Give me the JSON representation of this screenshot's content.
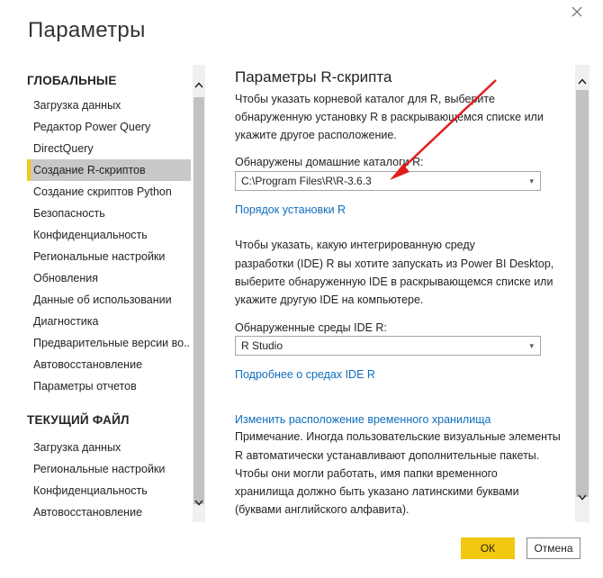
{
  "window": {
    "title": "Параметры",
    "close_glyph": "✕"
  },
  "sidebar": {
    "global_header": "ГЛОБАЛЬНЫЕ",
    "global_items": [
      {
        "label": "Загрузка данных"
      },
      {
        "label": "Редактор Power Query"
      },
      {
        "label": "DirectQuery"
      },
      {
        "label": "Создание R-скриптов",
        "selected": true
      },
      {
        "label": "Создание скриптов Python"
      },
      {
        "label": "Безопасность"
      },
      {
        "label": "Конфиденциальность"
      },
      {
        "label": "Региональные настройки"
      },
      {
        "label": "Обновления"
      },
      {
        "label": "Данные об использовании"
      },
      {
        "label": "Диагностика"
      },
      {
        "label": "Предварительные версии во..."
      },
      {
        "label": "Автовосстановление"
      },
      {
        "label": "Параметры отчетов"
      }
    ],
    "file_header": "ТЕКУЩИЙ ФАЙЛ",
    "file_items": [
      {
        "label": "Загрузка данных"
      },
      {
        "label": "Региональные настройки"
      },
      {
        "label": "Конфиденциальность"
      },
      {
        "label": "Автовосстановление"
      }
    ]
  },
  "main": {
    "title": "Параметры R-скрипта",
    "intro_lines": [
      "Чтобы указать корневой каталог для R, выберите",
      "обнаруженную установку R в раскрывающемся списке или",
      "укажите другое расположение."
    ],
    "home_dirs_label": "Обнаружены домашние каталоги R:",
    "home_dir_value": "C:\\Program Files\\R\\R-3.6.3",
    "install_order_link": "Порядок установки R",
    "ide_intro_lines": [
      "Чтобы указать, какую интегрированную среду",
      "разработки (IDE) R вы хотите запускать из Power BI Desktop,",
      "выберите обнаруженную IDE в раскрывающемся списке или",
      "укажите другую IDE на компьютере."
    ],
    "ide_label": "Обнаруженные среды IDE R:",
    "ide_value": "R Studio",
    "ide_more_link": "Подробнее о средах IDE R",
    "temp_storage_link": "Изменить расположение временного хранилища",
    "note_lines": [
      "Примечание. Иногда пользовательские визуальные элементы",
      "R автоматически устанавливают дополнительные пакеты.",
      "Чтобы они могли работать, имя папки временного",
      "хранилища должно быть указано латинскими буквами",
      "(буквами английского алфавита)."
    ]
  },
  "footer": {
    "ok_label": "ОК",
    "cancel_label": "Отмена"
  },
  "icons": {
    "scroll_up": "chevron-up-icon",
    "scroll_down": "chevron-down-icon",
    "dropdown": "chevron-down-icon"
  },
  "colors": {
    "accent": "#f2c811",
    "link": "#106ebe",
    "selected_bg": "#c8c8c8",
    "annotation_arrow": "#e01e1e"
  }
}
